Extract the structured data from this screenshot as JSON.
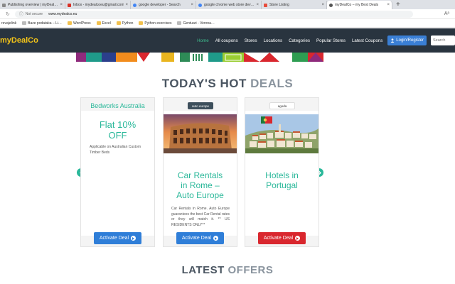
{
  "browser": {
    "tabs": [
      {
        "label": "Publishing overview | myDealCo",
        "icon": "publishing-icon",
        "color": "#888888",
        "active": false
      },
      {
        "label": "Inbox - mydealcoeu@gmail.com",
        "icon": "gmail-icon",
        "color": "#d93025",
        "active": false
      },
      {
        "label": "google developer - Search",
        "icon": "search-icon",
        "color": "#4285f4",
        "active": false
      },
      {
        "label": "google chrome web store develo…",
        "icon": "search-icon",
        "color": "#4285f4",
        "active": false
      },
      {
        "label": "Store Listing",
        "icon": "store-icon",
        "color": "#e74c3c",
        "active": false
      },
      {
        "label": "myDealCo – my Best Deals",
        "icon": "globe-icon",
        "color": "#555555",
        "active": true
      }
    ],
    "new_tab": "+",
    "address": {
      "security": "Not secure",
      "url": "www.mydealco.eu"
    },
    "bookmarks": [
      {
        "label": "revajelink",
        "type": "page"
      },
      {
        "label": "Baze podataka – Li…",
        "type": "page"
      },
      {
        "label": "WordPress",
        "type": "folder"
      },
      {
        "label": "Excel",
        "type": "folder"
      },
      {
        "label": "Python",
        "type": "folder"
      },
      {
        "label": "Python exercises",
        "type": "folder"
      },
      {
        "label": "Gentuari - Verona…",
        "type": "page"
      }
    ]
  },
  "site": {
    "logo": "myDealCo",
    "nav": [
      "Home",
      "All coupons",
      "Stores",
      "Locations",
      "Categories",
      "Popular Stores",
      "Latest Coupons"
    ],
    "active_nav": "Home",
    "login_label": "Login/Register",
    "search_placeholder": "Search",
    "colors": {
      "header": "#29343f",
      "accent": "#2bb89a",
      "logo": "#f5c518",
      "blue": "#2f7ed8",
      "red": "#d9272e"
    }
  },
  "hot_deals": {
    "heading_dark": "TODAY'S HOT",
    "heading_light": "DEALS",
    "cards": [
      {
        "store": "Bedworks Australia",
        "offer": "Flat 10% OFF",
        "offer_line1": "Flat 10%",
        "offer_line2": "OFF",
        "description": "Applicable on Australian Custom Timber Beds",
        "button": "Activate Deal",
        "button_color": "blue"
      },
      {
        "store_logo": "auto europe",
        "offer_line1": "Car Rentals",
        "offer_line2": "in Rome –",
        "offer_line3": "Auto Europe",
        "description": "Car Rentals in Rome. Auto Europe guarantees the best Car Rental rates or they will match it. ** US RESIDENTS ONLY**",
        "button": "Activate Deal",
        "button_color": "blue",
        "image": "colosseum"
      },
      {
        "store_logo": "agoda",
        "offer_line1": "Hotels in",
        "offer_line2": "Portugal",
        "description": "",
        "button": "Activate Deal",
        "button_color": "red",
        "image": "portugal-town"
      }
    ]
  },
  "latest": {
    "heading_dark": "LATEST",
    "heading_light": "OFFERS"
  }
}
